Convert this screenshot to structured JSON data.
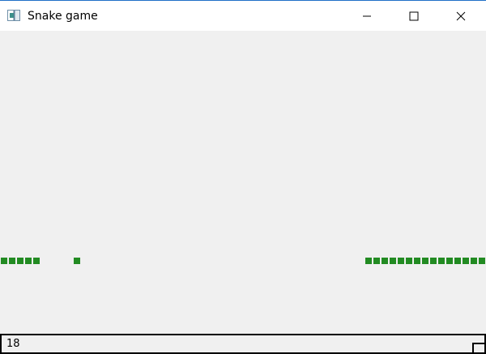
{
  "window": {
    "title": "Snake game",
    "icon": "app-window-icon"
  },
  "title_controls": {
    "minimize_icon": "minimize-icon",
    "maximize_icon": "maximize-icon",
    "close_icon": "close-icon"
  },
  "game": {
    "snake_color": "#228b22",
    "background_color": "#f0f0f0",
    "grid_cell": 10,
    "snake_segments": [
      [
        0,
        28
      ],
      [
        1,
        28
      ],
      [
        2,
        28
      ],
      [
        3,
        28
      ],
      [
        4,
        28
      ],
      [
        45,
        28
      ],
      [
        46,
        28
      ],
      [
        47,
        28
      ],
      [
        48,
        28
      ],
      [
        49,
        28
      ],
      [
        50,
        28
      ],
      [
        51,
        28
      ],
      [
        52,
        28
      ],
      [
        53,
        28
      ],
      [
        54,
        28
      ],
      [
        55,
        28
      ],
      [
        56,
        28
      ],
      [
        57,
        28
      ],
      [
        58,
        28
      ],
      [
        59,
        28
      ]
    ],
    "food": [
      9,
      28
    ]
  },
  "status": {
    "score": "18"
  }
}
